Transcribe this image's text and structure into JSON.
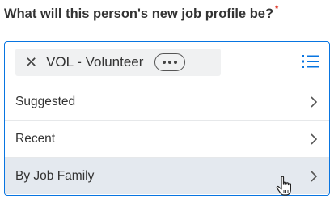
{
  "question": {
    "text": "What will this person's new job profile be?",
    "required_marker": "*"
  },
  "field": {
    "selected_chip": {
      "label": "VOL - Volunteer",
      "remove_icon": "close-icon",
      "more_icon": "ellipsis-icon"
    },
    "list_icon": "list-icon"
  },
  "menu": {
    "items": [
      {
        "label": "Suggested",
        "icon": "chevron-right-icon"
      },
      {
        "label": "Recent",
        "icon": "chevron-right-icon"
      },
      {
        "label": "By Job Family",
        "icon": "chevron-right-icon",
        "hovered": true
      }
    ]
  },
  "colors": {
    "accent": "#0875e1",
    "required": "#de3a2b",
    "hover_row": "#e4e9ef",
    "chip_bg": "#f0f1f2"
  }
}
